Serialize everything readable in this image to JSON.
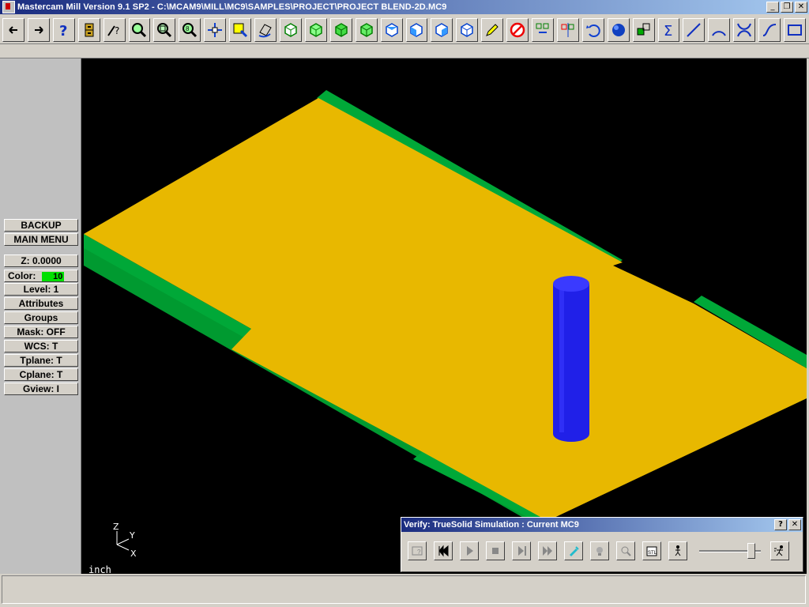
{
  "window": {
    "title": "Mastercam Mill Version 9.1 SP2 - C:\\MCAM9\\MILL\\MC9\\SAMPLES\\PROJECT\\PROJECT BLEND-2D.MC9"
  },
  "toolbar": {
    "buttons": [
      {
        "icon": "back-arrow-icon"
      },
      {
        "icon": "forward-arrow-icon"
      },
      {
        "icon": "help-icon"
      },
      {
        "icon": "file-cabinet-icon"
      },
      {
        "icon": "analyze-icon"
      },
      {
        "icon": "zoom-window-icon"
      },
      {
        "icon": "unzoom-icon"
      },
      {
        "icon": "zoom-selected-icon"
      },
      {
        "icon": "pan-icon"
      },
      {
        "icon": "select-icon"
      },
      {
        "icon": "rotate-view-icon"
      },
      {
        "icon": "cube-view-1-icon"
      },
      {
        "icon": "cube-view-2-icon"
      },
      {
        "icon": "cube-view-3-icon"
      },
      {
        "icon": "cube-view-4-icon"
      },
      {
        "icon": "cube-top-icon"
      },
      {
        "icon": "cube-front-icon"
      },
      {
        "icon": "cube-side-icon"
      },
      {
        "icon": "cube-iso-icon"
      },
      {
        "icon": "pencil-icon"
      },
      {
        "icon": "delete-icon"
      },
      {
        "icon": "translate-icon"
      },
      {
        "icon": "mirror-icon"
      },
      {
        "icon": "undo-icon"
      },
      {
        "icon": "shade-sphere-icon"
      },
      {
        "icon": "transform-icon"
      },
      {
        "icon": "sigma-icon"
      },
      {
        "icon": "line-icon"
      },
      {
        "icon": "arc-icon"
      },
      {
        "icon": "fillet-icon"
      },
      {
        "icon": "spline-icon"
      },
      {
        "icon": "rectangle-icon"
      }
    ]
  },
  "menu": {
    "backup": "BACKUP",
    "main_menu": "MAIN MENU",
    "z": "Z:  0.0000",
    "color_label": "Color:",
    "color_value": "10",
    "color_hex": "#00e000",
    "level": "Level:  1",
    "attributes": "Attributes",
    "groups": "Groups",
    "mask": "Mask:  OFF",
    "wcs": "WCS:   T",
    "tplane": "Tplane:  T",
    "cplane": "Cplane:  T",
    "gview": "Gview:   I"
  },
  "viewport": {
    "units": "inch",
    "axes": {
      "z": "Z",
      "y": "Y",
      "x": "X"
    },
    "colors": {
      "stock_top": "#e8b800",
      "stock_side": "#00a030",
      "tool": "#2020e8",
      "background": "#000000"
    }
  },
  "verify": {
    "title": "Verify: TrueSolid Simulation : Current MC9",
    "help": "?",
    "close": "✕",
    "speed_level": 0.9,
    "buttons": [
      {
        "icon": "options-icon"
      },
      {
        "icon": "rewind-icon"
      },
      {
        "icon": "play-icon"
      },
      {
        "icon": "stop-icon"
      },
      {
        "icon": "step-icon"
      },
      {
        "icon": "fast-forward-icon"
      },
      {
        "icon": "tool-display-icon"
      },
      {
        "icon": "lamp-icon"
      },
      {
        "icon": "zoom-verify-icon"
      },
      {
        "icon": "stl-save-icon"
      },
      {
        "icon": "walk-slow-icon"
      }
    ]
  }
}
